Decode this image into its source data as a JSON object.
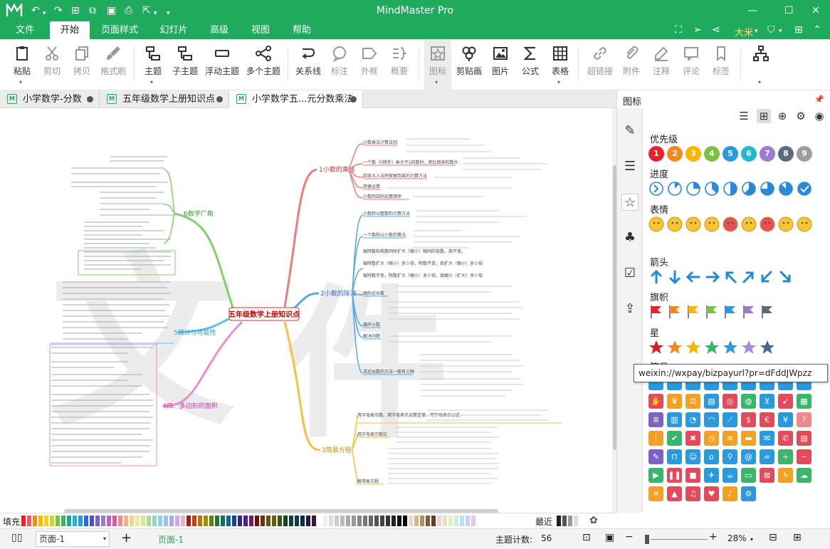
{
  "app": {
    "title": "MindMaster Pro",
    "user": "大米"
  },
  "menu": {
    "items": [
      "文件",
      "开始",
      "页面样式",
      "幻灯片",
      "高级",
      "视图",
      "帮助"
    ],
    "active": "开始"
  },
  "ribbon": {
    "buttons": [
      "粘贴",
      "剪切",
      "拷贝",
      "格式刷",
      "主题",
      "子主题",
      "浮动主题",
      "多个主题",
      "关系线",
      "标注",
      "外框",
      "概要",
      "图标",
      "剪贴画",
      "图片",
      "公式",
      "表格",
      "超链接",
      "附件",
      "注释",
      "评论",
      "标签"
    ]
  },
  "tabs": [
    "小学数学-分数",
    "五年级数学上册知识点",
    "小学数学五...元分数乘法"
  ],
  "mindmap": {
    "root": "五年级数学上册知识点",
    "branches": [
      "1小数的乘法",
      "2小数的除法",
      "3简易方程",
      "4四、多边形的面积",
      "5统计与可能性",
      "6数学广角"
    ],
    "subtopics": [
      "小数乘法计算法则",
      "一个数（0除外）乘大于1的数时，积比原来的数大",
      "四舍五入法积保留到某的计算方法",
      "简便运算",
      "小数的四则运算顺序",
      "小数除以整数的计算方法",
      "一个数除以小数的算法",
      "被除数和商数同时扩大（缩小）相同的倍数，商不变。",
      "被除数扩大（缩小）多少倍，除数不变，商扩大（缩小）多少倍",
      "被除数不变，除数扩大（缩小）多少倍，商缩小（扩大）多少倍",
      "商的近似数",
      "循环小数",
      "解决问题",
      "求近似数的方法一般有三种",
      "用字母表示数，用字母表示运算定律、用字母表示公式",
      "用字母表示数位",
      "解简易方程"
    ]
  },
  "panel": {
    "title": "图标",
    "sections": [
      "优先级",
      "进度",
      "表情",
      "箭头",
      "旗帜",
      "星",
      "符号"
    ],
    "priority": [
      "1",
      "2",
      "3",
      "4",
      "5",
      "6",
      "7",
      "8",
      "9"
    ],
    "priority_colors": [
      "#e8212d",
      "#f5871f",
      "#f7b500",
      "#7bc043",
      "#2a9ae0",
      "#21b7d0",
      "#9b7bd4",
      "#5a6b80",
      "#9e9e9e"
    ],
    "tooltip": "weixin://wxpay/bizpayurl?pr=dFddJWpzz"
  },
  "palette": {
    "fill_label": "填充",
    "recent_label": "最近"
  },
  "status": {
    "page_select": "页面-1",
    "page_tab": "页面-1",
    "topic_count_label": "主题计数:",
    "topic_count": "56",
    "zoom": "28%"
  }
}
